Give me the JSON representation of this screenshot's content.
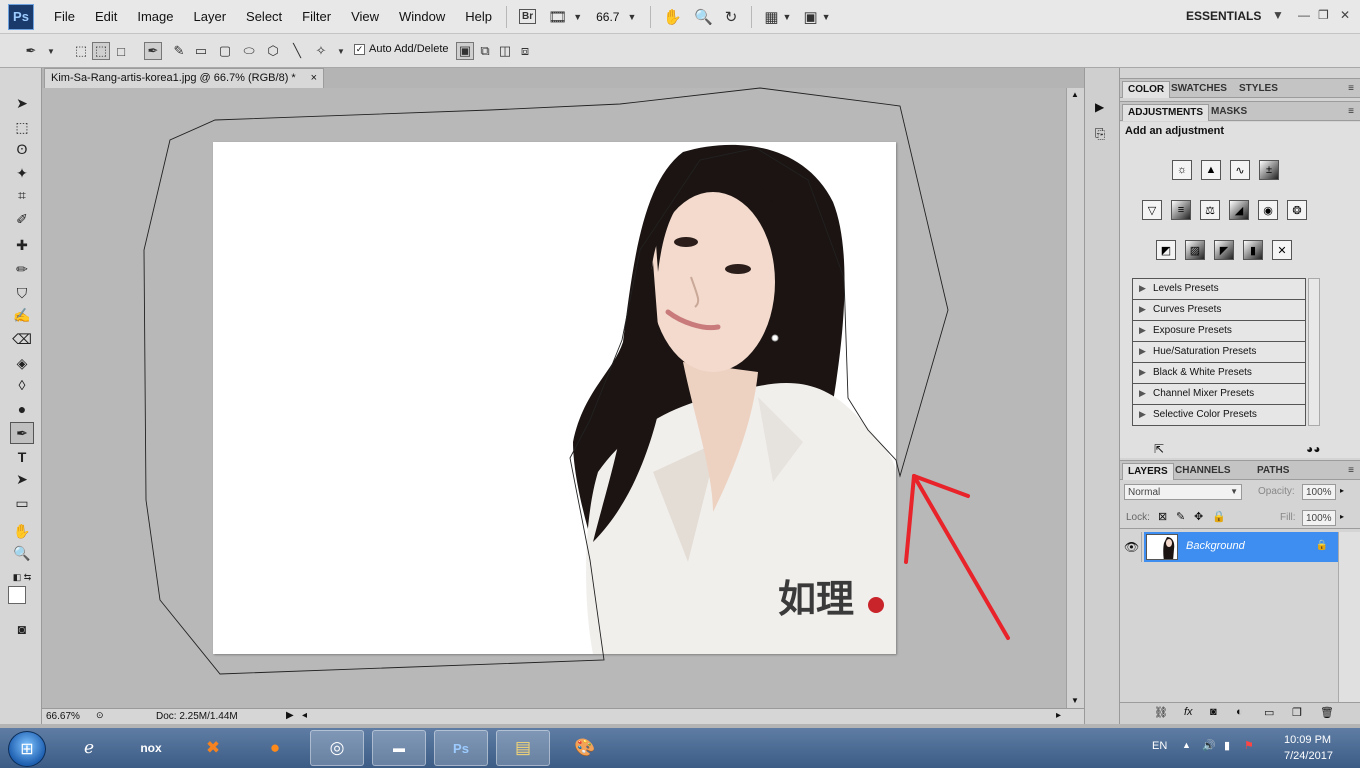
{
  "app": {
    "logo": "Ps"
  },
  "menubar": {
    "items": [
      "File",
      "Edit",
      "Image",
      "Layer",
      "Select",
      "Filter",
      "View",
      "Window",
      "Help"
    ],
    "bridge": "Br",
    "zoom": "66.7",
    "workspace": "ESSENTIALS"
  },
  "options": {
    "auto_add_delete": "Auto Add/Delete",
    "checkmark": "✓"
  },
  "document": {
    "tab_title": "Kim-Sa-Rang-artis-korea1.jpg @ 66.7% (RGB/8) *",
    "close": "×",
    "status_zoom": "66.67%",
    "status_doc": "Doc: 2.25M/1.44M"
  },
  "panels": {
    "top_tabs": [
      "COLOR",
      "SWATCHES",
      "STYLES"
    ],
    "adj_tabs": [
      "ADJUSTMENTS",
      "MASKS"
    ],
    "adj_heading": "Add an adjustment",
    "presets": [
      "Levels Presets",
      "Curves Presets",
      "Exposure Presets",
      "Hue/Saturation Presets",
      "Black & White Presets",
      "Channel Mixer Presets",
      "Selective Color Presets"
    ],
    "layer_tabs": [
      "LAYERS",
      "CHANNELS",
      "PATHS"
    ],
    "blend_mode": "Normal",
    "opacity_label": "Opacity:",
    "opacity_value": "100%",
    "lock_label": "Lock:",
    "fill_label": "Fill:",
    "fill_value": "100%",
    "layer_name": "Background"
  },
  "taskbar": {
    "lang": "EN",
    "time": "10:09 PM",
    "date": "7/24/2017",
    "apps": [
      "ie",
      "nox",
      "xampp",
      "firefox",
      "chrome",
      "cmd",
      "photoshop",
      "explorer",
      "paint"
    ],
    "app_labels": {
      "nox": "nox",
      "photoshop": "Ps"
    }
  },
  "colors": {
    "selection_blue": "#3d8ef0",
    "arrow_red": "#e8232a",
    "ps_logo_bg": "#1a3a6b"
  }
}
